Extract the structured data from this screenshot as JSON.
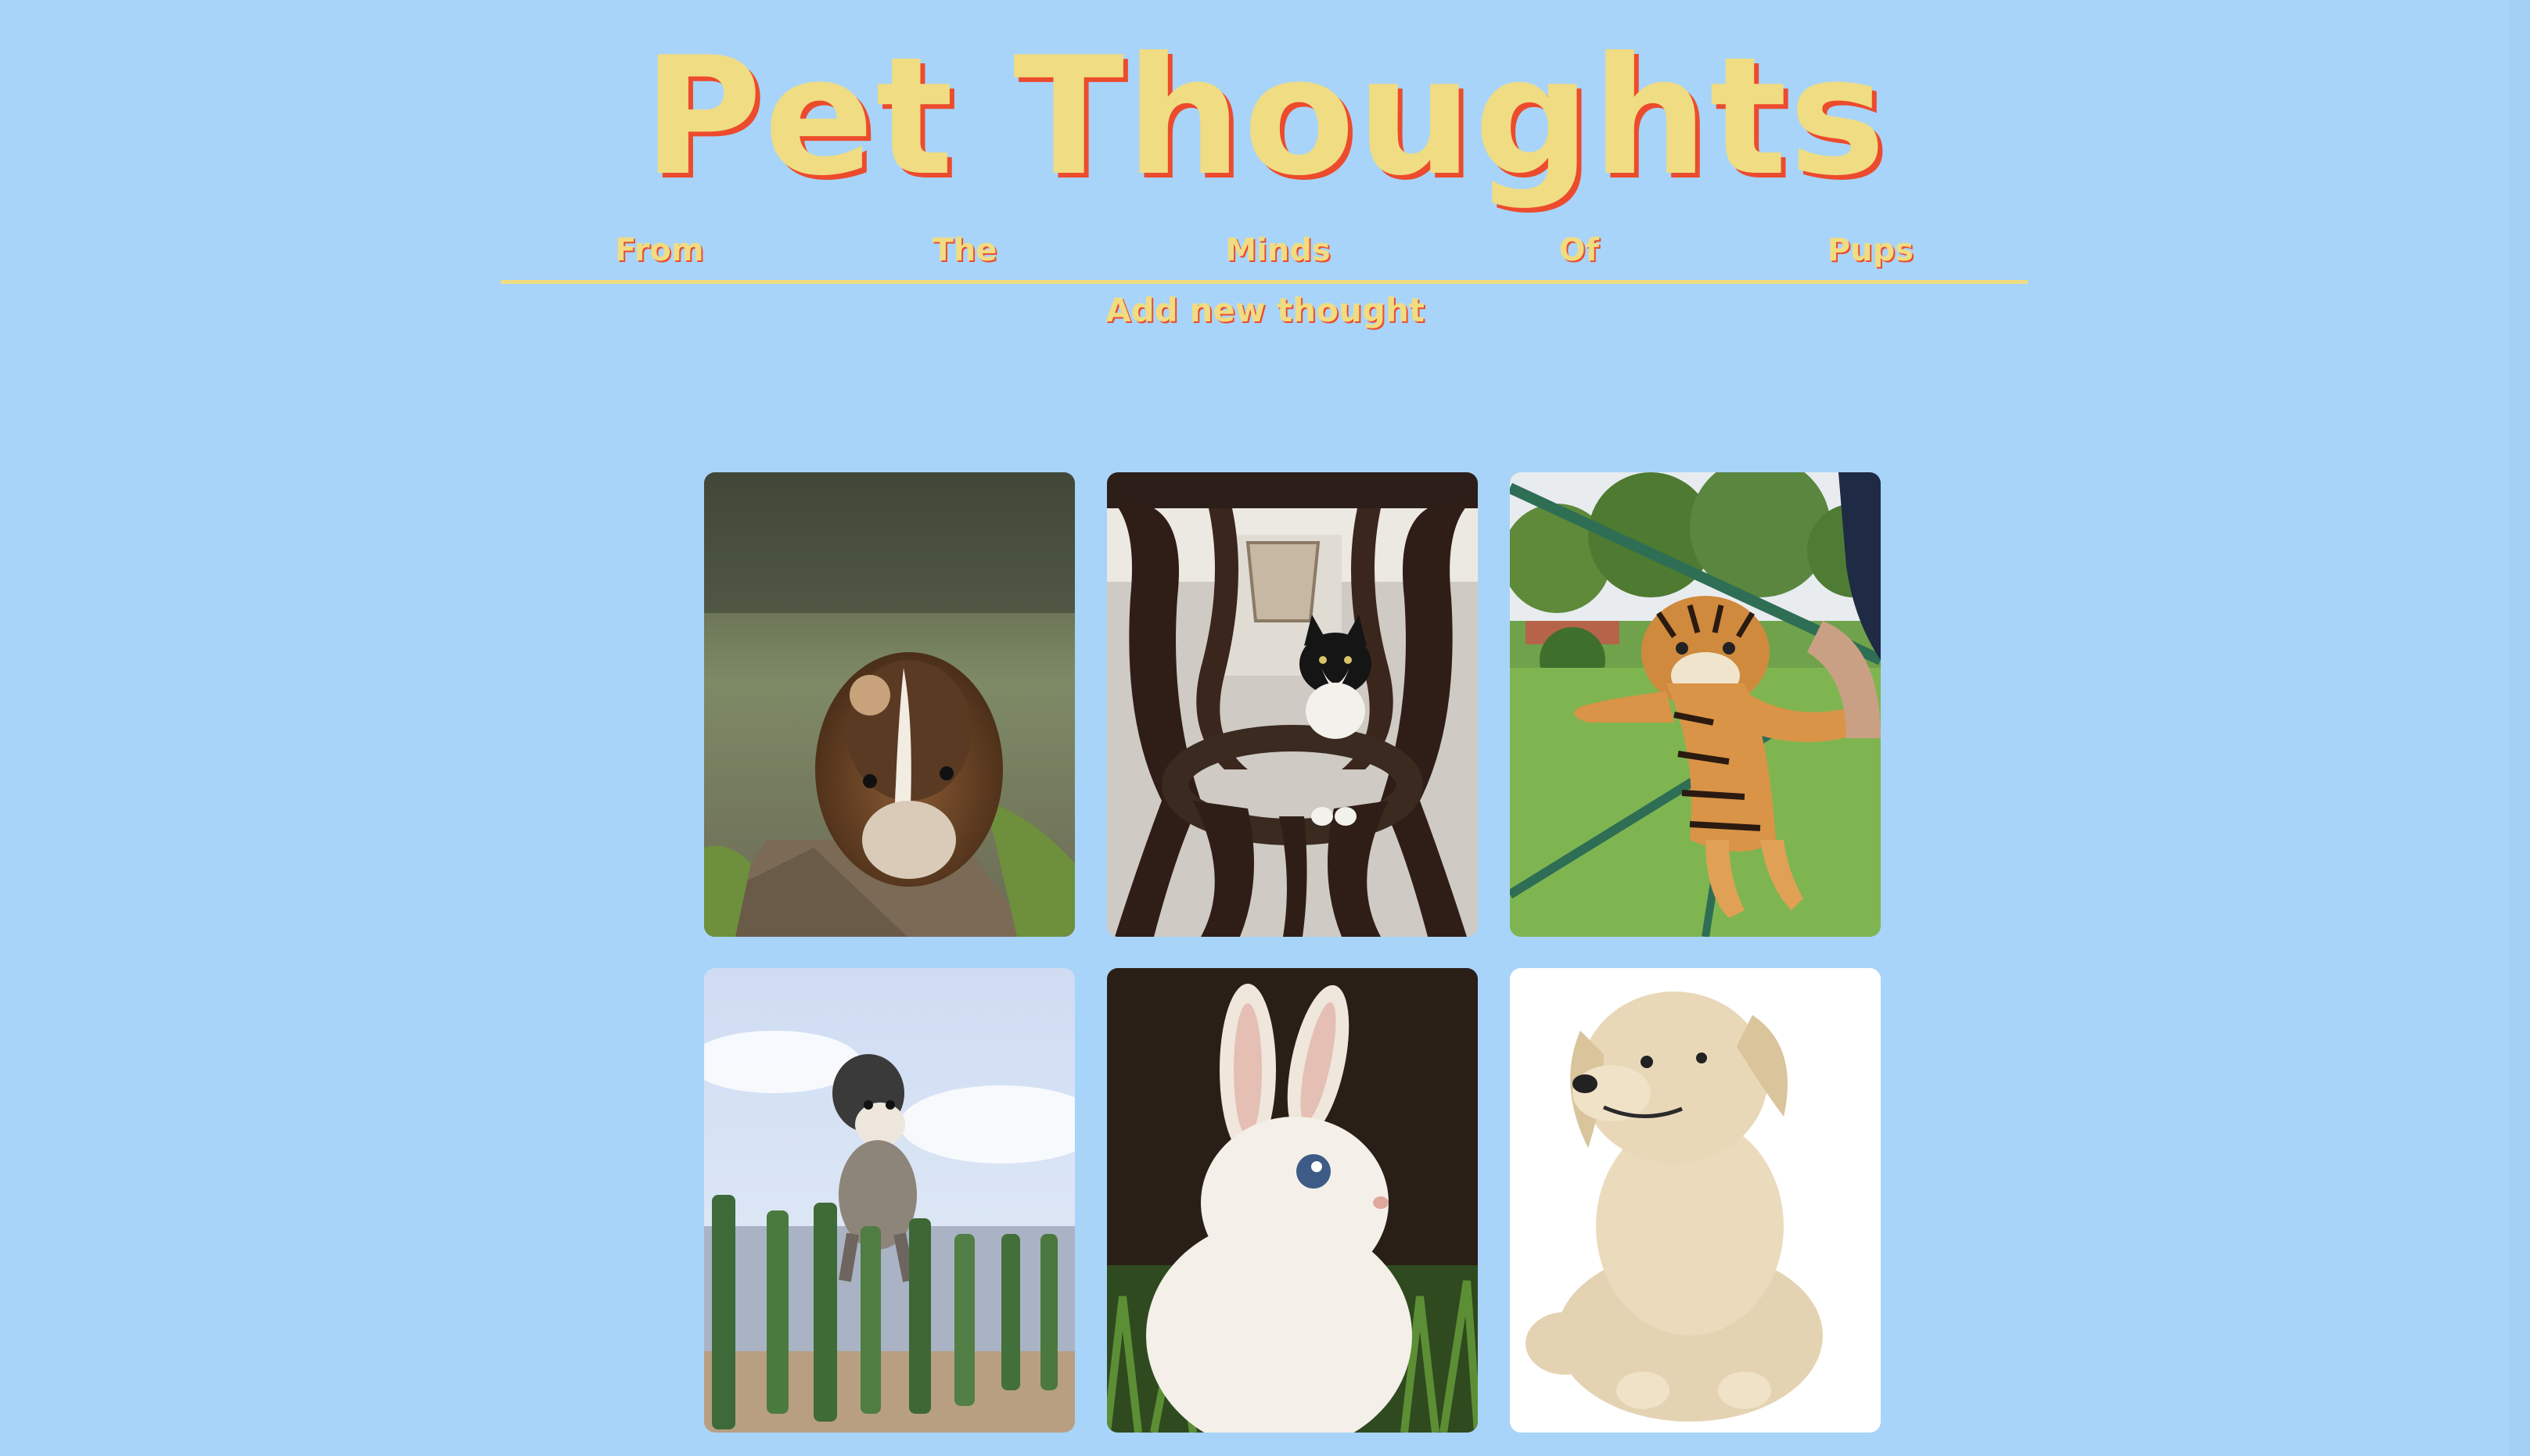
{
  "header": {
    "title": "Pet Thoughts"
  },
  "nav": {
    "items": [
      {
        "label": "From"
      },
      {
        "label": "The"
      },
      {
        "label": "Minds"
      },
      {
        "label": "Of"
      },
      {
        "label": "Pups"
      }
    ]
  },
  "actions": {
    "add_thought_label": "Add new thought"
  },
  "gallery": {
    "items": [
      {
        "icon": "guinea-pig-photo"
      },
      {
        "icon": "kitten-under-table-photo"
      },
      {
        "icon": "tiger-cub-photo"
      },
      {
        "icon": "jumping-dog-beach-photo"
      },
      {
        "icon": "white-bunny-photo"
      },
      {
        "icon": "labrador-puppy-photo"
      }
    ]
  },
  "colors": {
    "background": "#a8d4f9",
    "title_fill": "#f0dc82",
    "title_shadow": "#ec4b2d"
  }
}
